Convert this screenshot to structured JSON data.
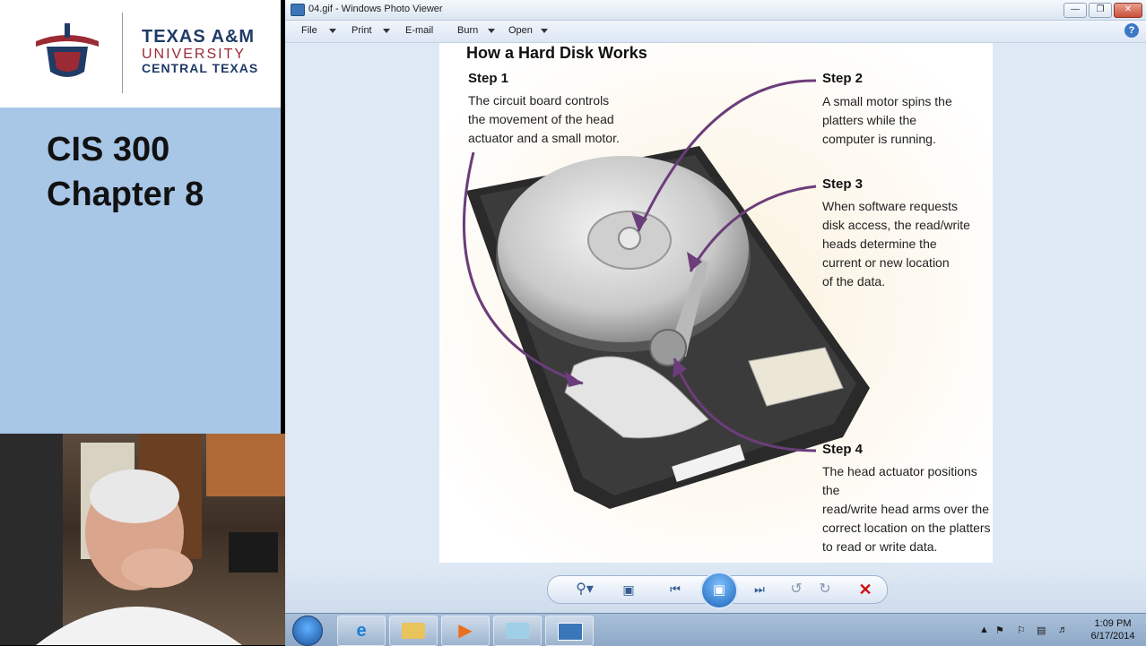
{
  "slide": {
    "logo_line1": "TEXAS A&M",
    "logo_line2": "UNIVERSITY",
    "logo_line3": "CENTRAL TEXAS",
    "title_line1": "CIS 300",
    "title_line2": "Chapter 8"
  },
  "window": {
    "title": "04.gif - Windows Photo Viewer",
    "menu": [
      "File",
      "Print",
      "E-mail",
      "Burn",
      "Open"
    ]
  },
  "figure": {
    "title": "How a Hard Disk Works",
    "steps": [
      {
        "head": "Step 1",
        "lines": [
          "The circuit board controls",
          "the movement of the head",
          "actuator and a small motor."
        ]
      },
      {
        "head": "Step 2",
        "lines": [
          "A small motor spins the",
          "platters while the",
          "computer is running."
        ]
      },
      {
        "head": "Step 3",
        "lines": [
          "When software requests",
          "disk access, the read/write",
          "heads determine the",
          "current or new location",
          "of the data."
        ]
      },
      {
        "head": "Step 4",
        "lines": [
          "The head actuator positions the",
          "read/write head arms over the",
          "correct location on the platters",
          "to read or write data."
        ]
      }
    ]
  },
  "taskbar": {
    "clock_time": "1:09 PM",
    "clock_date": "6/17/2014"
  },
  "colors": {
    "accent_blue": "#1b63b8",
    "slide_bg": "#a8c6e6",
    "arrow_purple": "#6b3d7a",
    "delete_red": "#cc1111"
  }
}
